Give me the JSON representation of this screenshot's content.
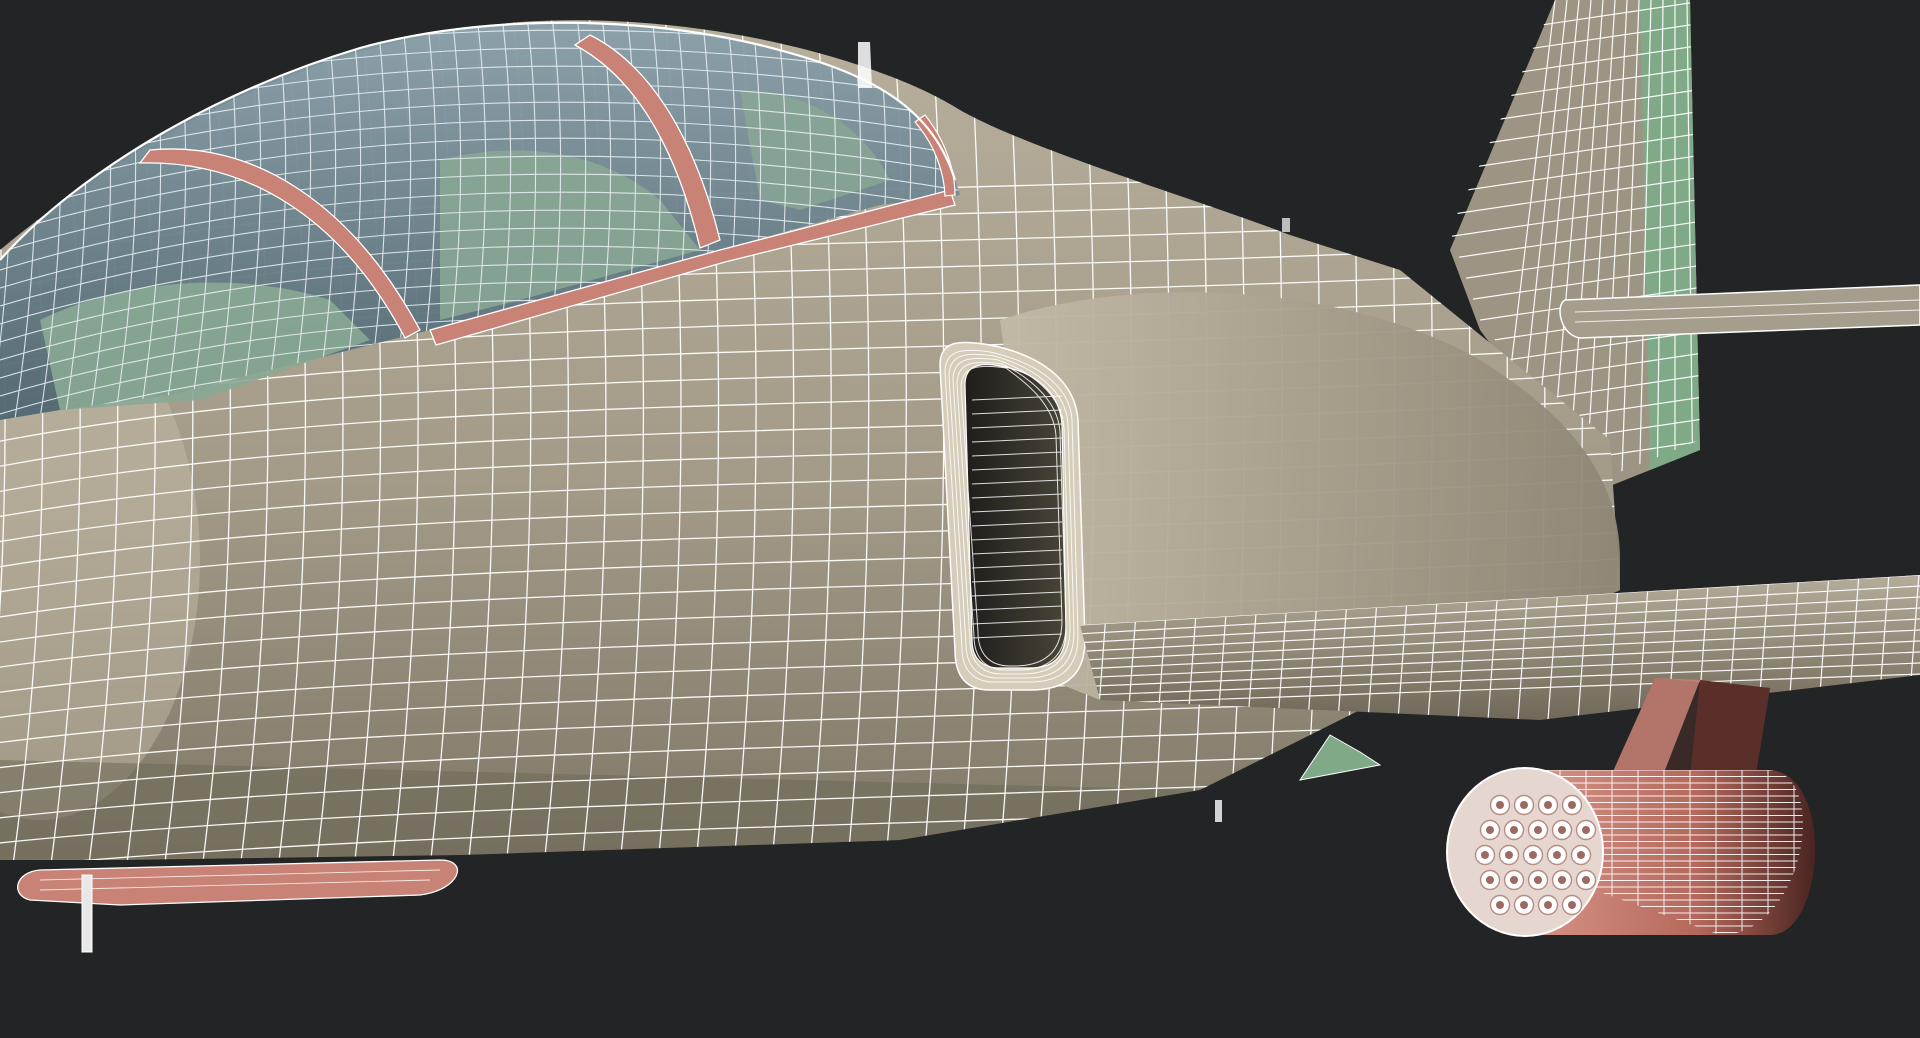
{
  "scene": {
    "subject": "wireframe-jet-render",
    "colors": {
      "background": "#222426",
      "fuselage": "#a59d8b",
      "fuselage_shadow": "#7b7363",
      "intake_dark": "#2a2824",
      "canopy_glass": "#6f8894",
      "canopy_green": "#8aa894",
      "canopy_frame": "#c98276",
      "tail_accent": "#7fa987",
      "pod": "#c98276",
      "pod_dark": "#6e3a33",
      "wire": "#ffffff"
    }
  }
}
